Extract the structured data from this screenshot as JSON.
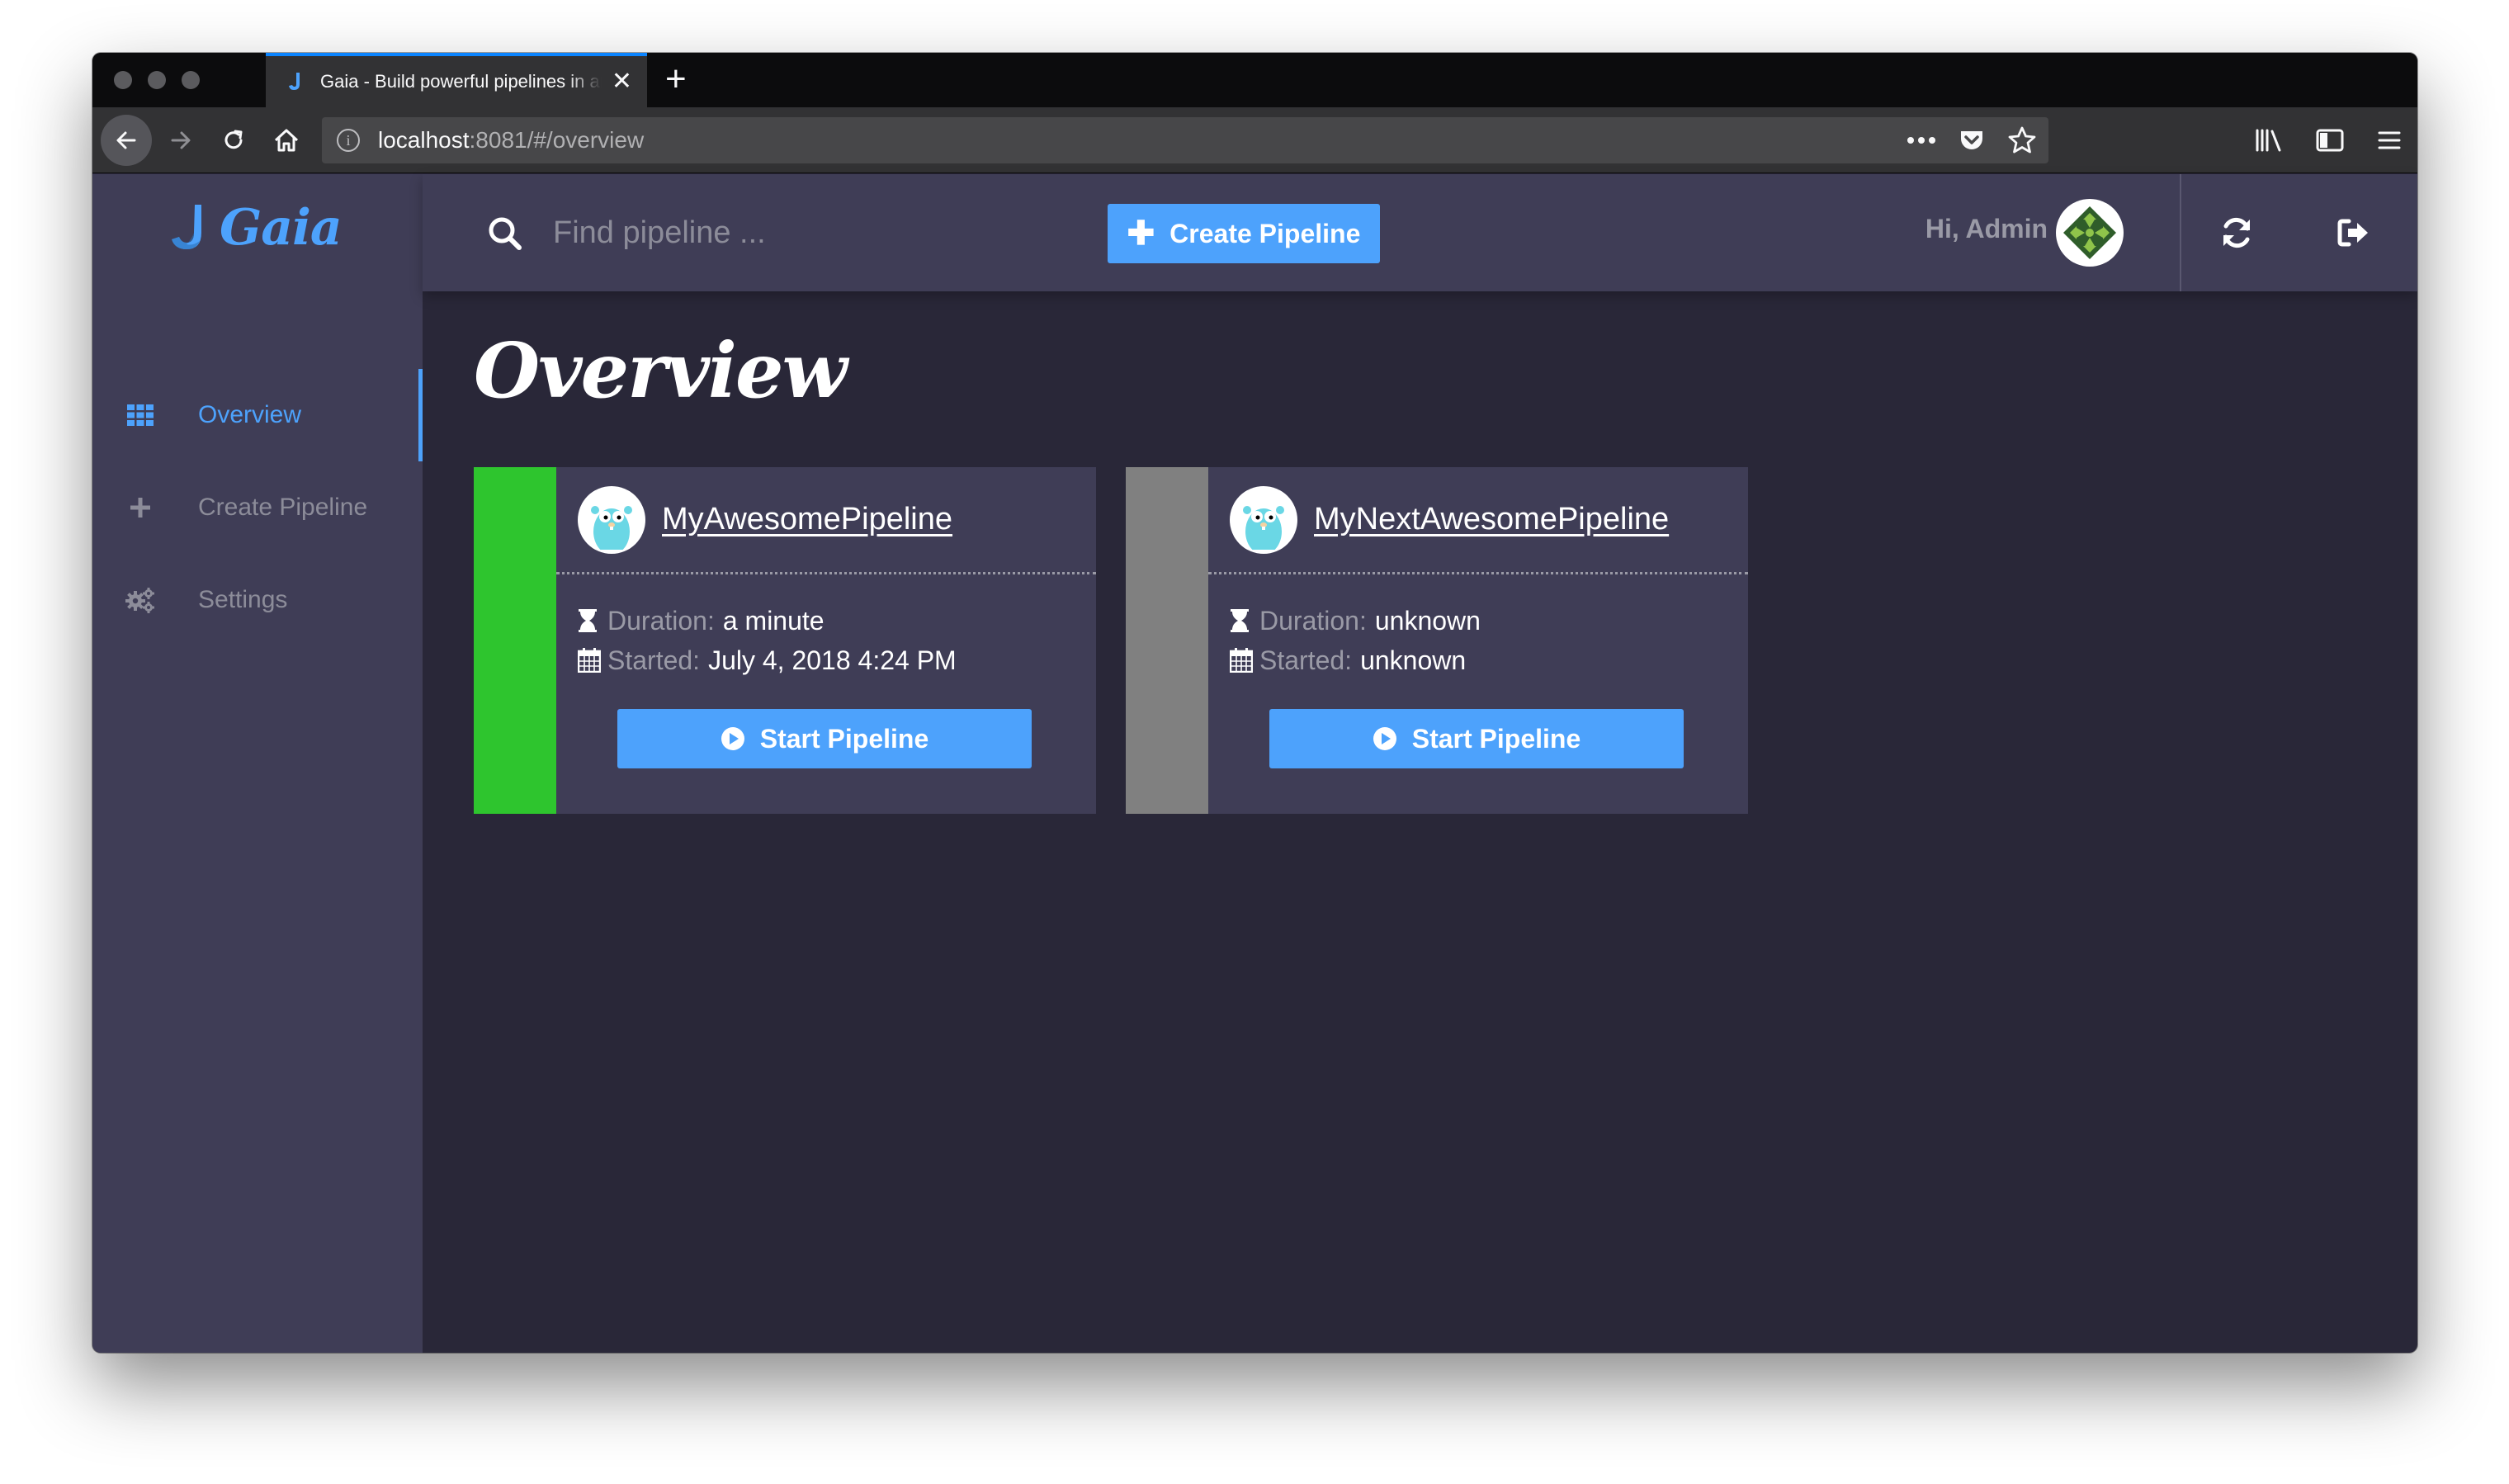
{
  "browser": {
    "tab_title": "Gaia - Build powerful pipelines in any language",
    "url_host": "localhost",
    "url_rest": ":8081/#/overview"
  },
  "app": {
    "logo_text": "Gaia",
    "search_placeholder": "Find pipeline ...",
    "create_button_label": "Create Pipeline",
    "greeting": "Hi, Admin"
  },
  "sidebar": {
    "items": [
      {
        "label": "Overview",
        "icon": "grid-icon",
        "active": true
      },
      {
        "label": "Create Pipeline",
        "icon": "plus-icon",
        "active": false
      },
      {
        "label": "Settings",
        "icon": "cogs-icon",
        "active": false
      }
    ]
  },
  "main": {
    "title": "Overview",
    "pipelines": [
      {
        "name": "MyAwesomePipeline",
        "status_color": "#2ec52e",
        "duration_label": "Duration:",
        "duration": "a minute",
        "started_label": "Started:",
        "started": "July 4, 2018 4:24 PM",
        "button_label": "Start Pipeline"
      },
      {
        "name": "MyNextAwesomePipeline",
        "status_color": "#808080",
        "duration_label": "Duration:",
        "duration": "unknown",
        "started_label": "Started:",
        "started": "unknown",
        "button_label": "Start Pipeline"
      }
    ]
  },
  "colors": {
    "accent": "#4da2fc",
    "sidebar_bg": "#3f3d56",
    "content_bg": "#292738",
    "success": "#2ec52e",
    "unknown": "#808080"
  }
}
